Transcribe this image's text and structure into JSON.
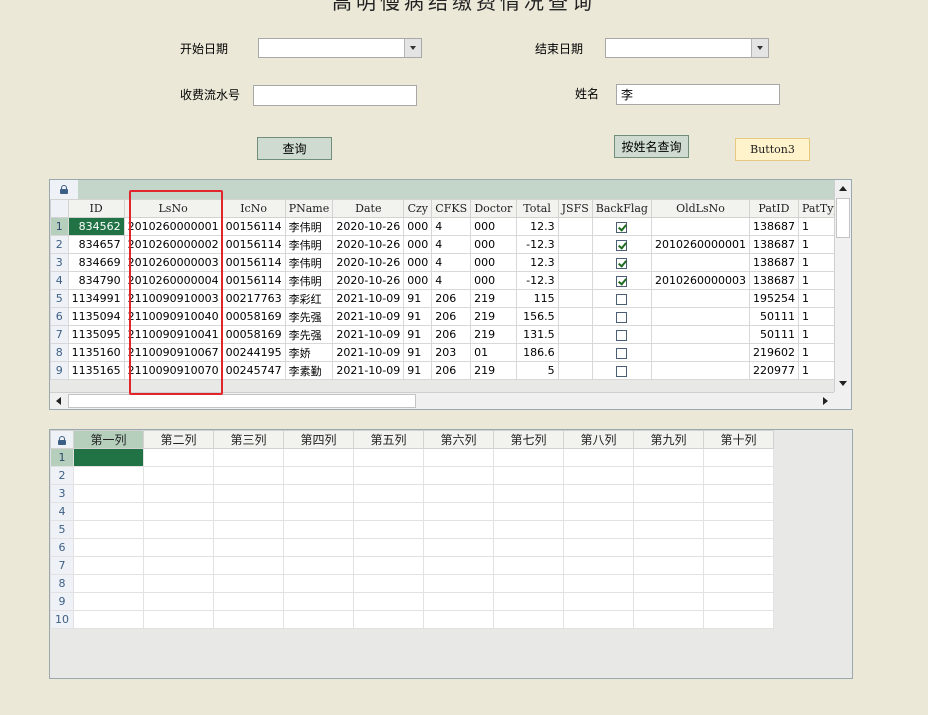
{
  "form": {
    "title": "高明慢病结缴费情况查询",
    "start_date_label": "开始日期",
    "start_date_value": "",
    "end_date_label": "结束日期",
    "end_date_value": "",
    "serial_label": "收费流水号",
    "serial_value": "",
    "name_label": "姓名",
    "name_value": "李",
    "query_button": "查询",
    "name_query_button": "按姓名查询",
    "button3": "Button3"
  },
  "grid1": {
    "columns": [
      "ID",
      "LsNo",
      "IcNo",
      "PName",
      "Date",
      "Czy",
      "CFKS",
      "Doctor",
      "Total",
      "JSFS",
      "BackFlag",
      "OldLsNo",
      "PatID",
      "PatType"
    ],
    "rows": [
      {
        "n": "1",
        "id": "834562",
        "lsno": "2010260000001",
        "icno": "00156114",
        "pname": "李伟明",
        "date": "2020-10-26",
        "czy": "000",
        "cfks": "4",
        "doctor": "000",
        "total": "12.3",
        "jsfs": "",
        "back": true,
        "oldlsno": "",
        "patid": "138687",
        "pattype": "1"
      },
      {
        "n": "2",
        "id": "834657",
        "lsno": "2010260000002",
        "icno": "00156114",
        "pname": "李伟明",
        "date": "2020-10-26",
        "czy": "000",
        "cfks": "4",
        "doctor": "000",
        "total": "-12.3",
        "jsfs": "",
        "back": true,
        "oldlsno": "2010260000001",
        "patid": "138687",
        "pattype": "1"
      },
      {
        "n": "3",
        "id": "834669",
        "lsno": "2010260000003",
        "icno": "00156114",
        "pname": "李伟明",
        "date": "2020-10-26",
        "czy": "000",
        "cfks": "4",
        "doctor": "000",
        "total": "12.3",
        "jsfs": "",
        "back": true,
        "oldlsno": "",
        "patid": "138687",
        "pattype": "1"
      },
      {
        "n": "4",
        "id": "834790",
        "lsno": "2010260000004",
        "icno": "00156114",
        "pname": "李伟明",
        "date": "2020-10-26",
        "czy": "000",
        "cfks": "4",
        "doctor": "000",
        "total": "-12.3",
        "jsfs": "",
        "back": true,
        "oldlsno": "2010260000003",
        "patid": "138687",
        "pattype": "1"
      },
      {
        "n": "5",
        "id": "1134991",
        "lsno": "2110090910003",
        "icno": "00217763",
        "pname": "李彩红",
        "date": "2021-10-09",
        "czy": "91",
        "cfks": "206",
        "doctor": "219",
        "total": "115",
        "jsfs": "",
        "back": false,
        "oldlsno": "",
        "patid": "195254",
        "pattype": "1"
      },
      {
        "n": "6",
        "id": "1135094",
        "lsno": "2110090910040",
        "icno": "00058169",
        "pname": "李先强",
        "date": "2021-10-09",
        "czy": "91",
        "cfks": "206",
        "doctor": "219",
        "total": "156.5",
        "jsfs": "",
        "back": false,
        "oldlsno": "",
        "patid": "50111",
        "pattype": "1"
      },
      {
        "n": "7",
        "id": "1135095",
        "lsno": "2110090910041",
        "icno": "00058169",
        "pname": "李先强",
        "date": "2021-10-09",
        "czy": "91",
        "cfks": "206",
        "doctor": "219",
        "total": "131.5",
        "jsfs": "",
        "back": false,
        "oldlsno": "",
        "patid": "50111",
        "pattype": "1"
      },
      {
        "n": "8",
        "id": "1135160",
        "lsno": "2110090910067",
        "icno": "00244195",
        "pname": "李娇",
        "date": "2021-10-09",
        "czy": "91",
        "cfks": "203",
        "doctor": "01",
        "total": "186.6",
        "jsfs": "",
        "back": false,
        "oldlsno": "",
        "patid": "219602",
        "pattype": "1"
      },
      {
        "n": "9",
        "id": "1135165",
        "lsno": "2110090910070",
        "icno": "00245747",
        "pname": "李素勤",
        "date": "2021-10-09",
        "czy": "91",
        "cfks": "206",
        "doctor": "219",
        "total": "5",
        "jsfs": "",
        "back": false,
        "oldlsno": "",
        "patid": "220977",
        "pattype": "1"
      }
    ]
  },
  "grid2": {
    "columns": [
      "第一列",
      "第二列",
      "第三列",
      "第四列",
      "第五列",
      "第六列",
      "第七列",
      "第八列",
      "第九列",
      "第十列"
    ],
    "row_numbers": [
      "1",
      "2",
      "3",
      "4",
      "5",
      "6",
      "7",
      "8",
      "9",
      "10"
    ]
  },
  "colors": {
    "background": "#ebe8d8",
    "selection": "#217346",
    "header_active": "#b6cfbd",
    "highlight": "#e2252a"
  }
}
